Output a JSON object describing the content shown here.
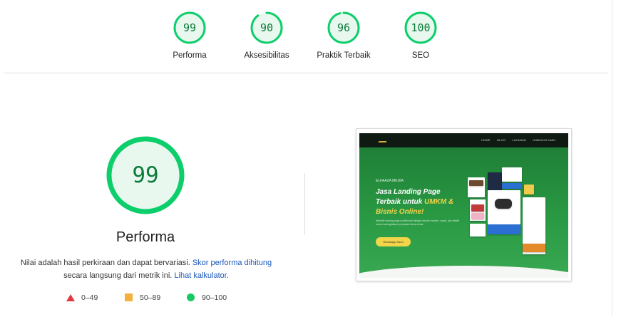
{
  "scores": [
    {
      "label": "Performa",
      "value": "99",
      "fraction": 0.99
    },
    {
      "label": "Aksesibilitas",
      "value": "90",
      "fraction": 0.9
    },
    {
      "label": "Praktik Terbaik",
      "value": "96",
      "fraction": 0.96
    },
    {
      "label": "SEO",
      "value": "100",
      "fraction": 1.0
    }
  ],
  "main": {
    "score": "99",
    "fraction": 0.99,
    "title": "Performa",
    "desc_part1": "Nilai adalah hasil perkiraan dan dapat bervariasi. ",
    "desc_link1": "Skor performa dihitung",
    "desc_part2": "secara langsung dari metrik ini. ",
    "desc_link2": "Lihat kalkulator",
    "desc_part3": "."
  },
  "legend": [
    {
      "range": "0–49",
      "color": "#e0393e",
      "shape": "triangle"
    },
    {
      "range": "50–89",
      "color": "#f4b03d",
      "shape": "square"
    },
    {
      "range": "90–100",
      "color": "#18c964",
      "shape": "circle"
    }
  ],
  "colors": {
    "pass": "#0cce6b",
    "pass_text": "#0c7a3a",
    "pass_bg": "#e8f8ee",
    "link": "#1a57b8"
  },
  "screenshot": {
    "nav_links": [
      "HOME",
      "BLOG",
      "LAYANAN",
      "HUBUNGI KAMI"
    ],
    "brand": "ELFAAZA MEDIA",
    "headline_1": "Jasa Landing Page Terbaik untuk ",
    "headline_highlight": "UMKM & Bisnis Online!",
    "subtext": "Website landing page profesional dengan desain modern, cepat, dan efektif untuk meningkatkan penjualan bisnis Anda.",
    "cta": "Whatsapp Kami"
  }
}
